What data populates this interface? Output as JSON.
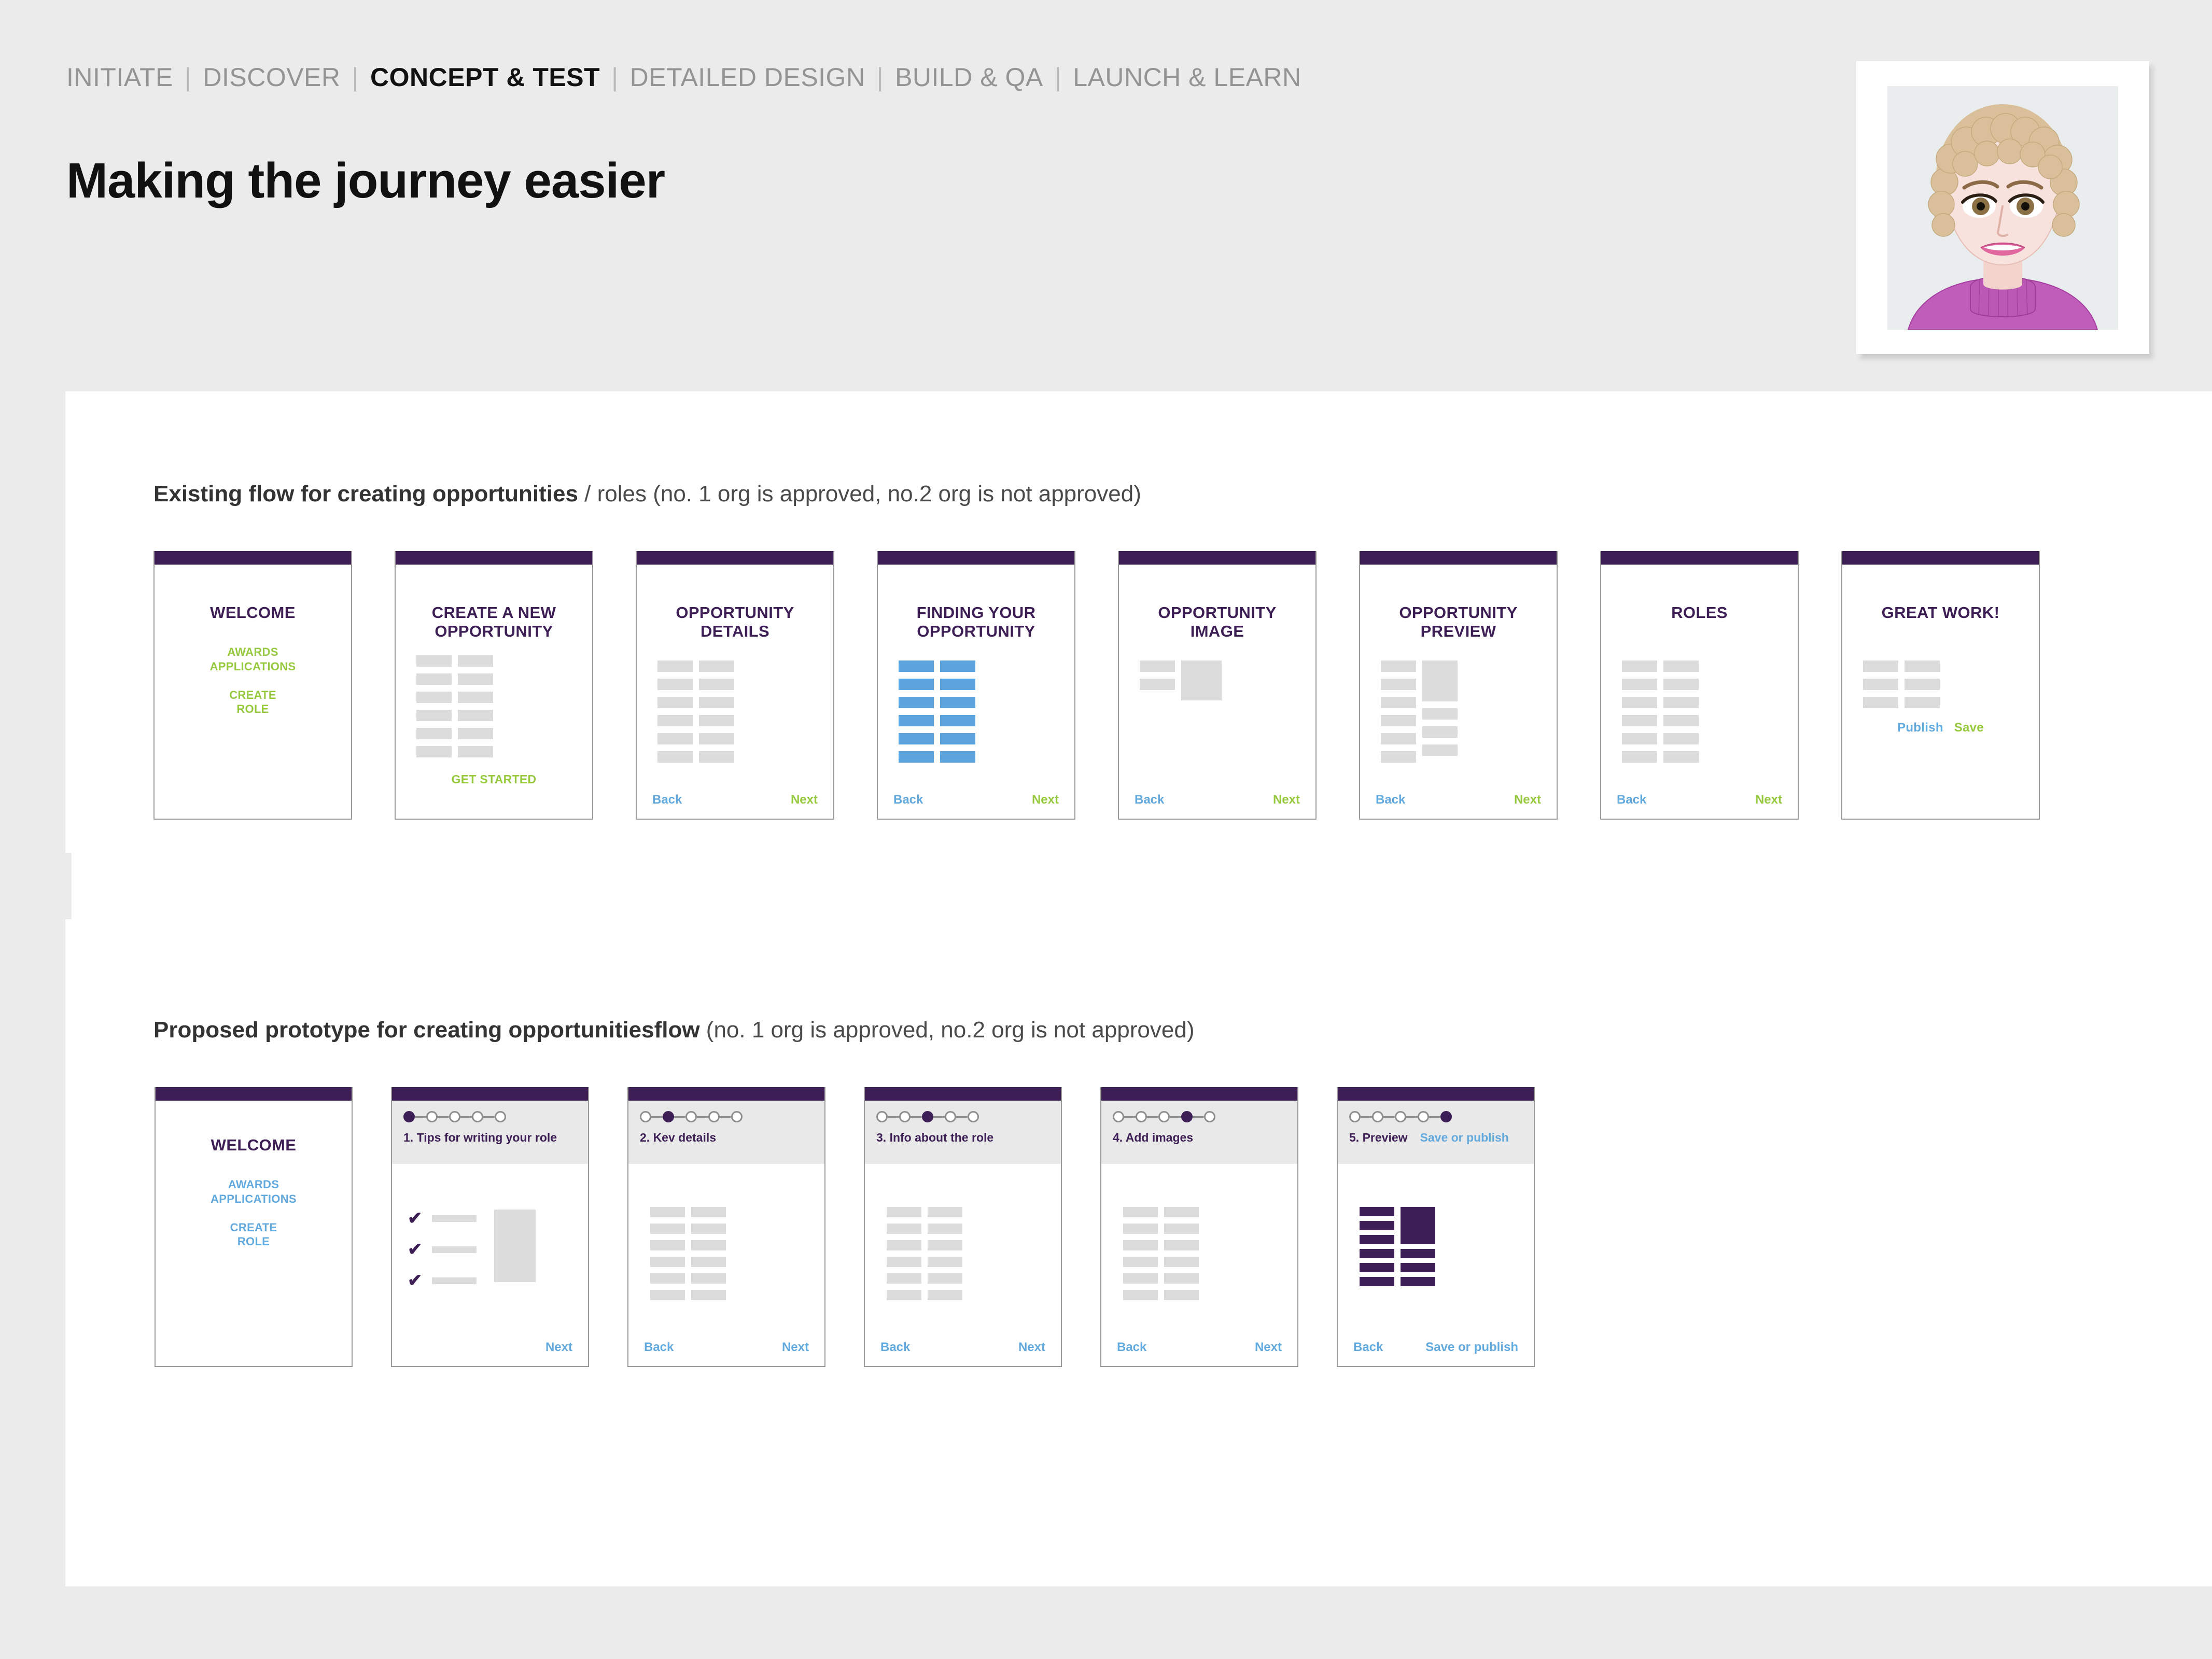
{
  "nav": {
    "items": [
      {
        "label": "INITIATE",
        "active": false
      },
      {
        "label": "DISCOVER",
        "active": false
      },
      {
        "label": "CONCEPT & TEST",
        "active": true
      },
      {
        "label": "DETAILED DESIGN",
        "active": false
      },
      {
        "label": "BUILD & QA",
        "active": false
      },
      {
        "label": "LAUNCH & LEARN",
        "active": false
      }
    ],
    "separator": "|"
  },
  "page_title": "Making the journey easier",
  "avatar": {
    "name": "persona-portrait",
    "description": "Illustrated portrait of a woman with short curly blonde hair wearing a purple turtleneck",
    "hair_color": "#d9c09a",
    "skin_color": "#f6ddd8",
    "sweater_color": "#c05cba",
    "background_color": "#e9edee"
  },
  "colors": {
    "purple": "#3d1f56",
    "green": "#96c93d",
    "blue": "#62a9de",
    "bar_blue": "#5ba4dd",
    "skeleton_grey": "#dcdcdc",
    "page_bg": "#ebebeb",
    "panel_bg": "#ffffff"
  },
  "sections": [
    {
      "heading_strong": "Existing flow for creating opportunities",
      "heading_light": " / roles (no. 1 org is approved, no.2 org is not approved)",
      "cards": [
        {
          "title": "WELCOME",
          "type": "welcome",
          "links": [
            "AWARDS\nAPPLICATIONS",
            "CREATE\nROLE"
          ],
          "link_color": "green",
          "footer": []
        },
        {
          "title": "CREATE A NEW\nOPPORTUNITY",
          "type": "bars",
          "bar_rows": 6,
          "bar_color": "grey",
          "cta": "GET STARTED",
          "cta_color": "green",
          "footer": []
        },
        {
          "title": "OPPORTUNITY\nDETAILS",
          "type": "bars",
          "bar_rows": 6,
          "bar_color": "grey",
          "footer": [
            {
              "label": "Back",
              "color": "blue"
            },
            {
              "label": "Next",
              "color": "green"
            }
          ]
        },
        {
          "title": "FINDING YOUR\nOPPORTUNITY",
          "type": "bars",
          "bar_rows": 6,
          "bar_color": "blue",
          "footer": [
            {
              "label": "Back",
              "color": "blue"
            },
            {
              "label": "Next",
              "color": "green"
            }
          ]
        },
        {
          "title": "OPPORTUNITY\nIMAGE",
          "type": "image-block",
          "bar_rows": 2,
          "bar_color": "grey",
          "footer": [
            {
              "label": "Back",
              "color": "blue"
            },
            {
              "label": "Next",
              "color": "green"
            }
          ]
        },
        {
          "title": "OPPORTUNITY\nPREVIEW",
          "type": "preview",
          "bar_rows": 6,
          "bar_color": "grey",
          "footer": [
            {
              "label": "Back",
              "color": "blue"
            },
            {
              "label": "Next",
              "color": "green"
            }
          ]
        },
        {
          "title": "ROLES",
          "type": "bars",
          "bar_rows": 6,
          "bar_color": "grey",
          "footer": [
            {
              "label": "Back",
              "color": "blue"
            },
            {
              "label": "Next",
              "color": "green"
            }
          ]
        },
        {
          "title": "GREAT WORK!",
          "type": "bars-short",
          "bar_rows": 3,
          "bar_color": "grey",
          "actions": [
            {
              "label": "Publish",
              "color": "blue"
            },
            {
              "label": "Save",
              "color": "green"
            }
          ],
          "footer": []
        }
      ]
    },
    {
      "heading_strong": "Proposed prototype for creating opportunitiesflow",
      "heading_light": " (no. 1 org is approved, no.2 org is not approved)",
      "cards": [
        {
          "title": "WELCOME",
          "type": "welcome",
          "links": [
            "AWARDS\nAPPLICATIONS",
            "CREATE\nROLE"
          ],
          "link_color": "blue",
          "footer": []
        },
        {
          "type": "proto",
          "step": 1,
          "steps_total": 5,
          "label": "1. Tips for writing your role",
          "content": "checklist",
          "footer": [
            {
              "label": "Next",
              "color": "blue"
            }
          ]
        },
        {
          "type": "proto",
          "step": 2,
          "steps_total": 5,
          "label": "2. Kev details",
          "content": "bars",
          "bar_rows": 6,
          "bar_color": "grey",
          "footer": [
            {
              "label": "Back",
              "color": "blue"
            },
            {
              "label": "Next",
              "color": "blue"
            }
          ]
        },
        {
          "type": "proto",
          "step": 3,
          "steps_total": 5,
          "label": "3. Info about the role",
          "content": "bars",
          "bar_rows": 6,
          "bar_color": "grey",
          "footer": [
            {
              "label": "Back",
              "color": "blue"
            },
            {
              "label": "Next",
              "color": "blue"
            }
          ]
        },
        {
          "type": "proto",
          "step": 4,
          "steps_total": 5,
          "label": "4. Add images",
          "content": "bars",
          "bar_rows": 6,
          "bar_color": "grey",
          "footer": [
            {
              "label": "Back",
              "color": "blue"
            },
            {
              "label": "Next",
              "color": "blue"
            }
          ]
        },
        {
          "type": "proto",
          "step": 5,
          "steps_total": 5,
          "label": "5. Preview",
          "label_action": "Save or publish",
          "content": "preview-purple",
          "bar_rows": 6,
          "bar_color": "purple",
          "footer": [
            {
              "label": "Back",
              "color": "blue"
            },
            {
              "label": "Save or publish",
              "color": "blue"
            }
          ]
        }
      ]
    }
  ]
}
